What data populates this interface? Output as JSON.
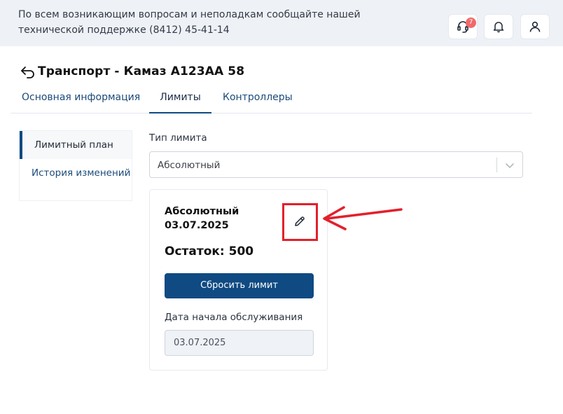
{
  "topbar": {
    "support_message": "По всем возникающим вопросам и неполадкам сообщайте нашей технической поддержке (8412) 45-41-14",
    "support_badge": "7"
  },
  "icons": {
    "support": "headset-icon",
    "notifications": "bell-icon",
    "user": "user-icon",
    "back": "back-arrow-icon",
    "edit": "pencil-icon",
    "dropdown": "chevron-down-icon"
  },
  "page": {
    "title": "Транспорт - Камаз А123АА 58"
  },
  "tabs": [
    {
      "label": "Основная информация",
      "active": false
    },
    {
      "label": "Лимиты",
      "active": true
    },
    {
      "label": "Контроллеры",
      "active": false
    }
  ],
  "side_nav": [
    {
      "label": "Лимитный план",
      "active": true
    },
    {
      "label": "История изменений",
      "active": false
    }
  ],
  "limit_type": {
    "label": "Тип лимита",
    "value": "Абсолютный"
  },
  "limit_card": {
    "type": "Абсолютный",
    "date": "03.07.2025",
    "remainder": "Остаток: 500",
    "reset_button": "Сбросить лимит",
    "service_start_label": "Дата начала обслуживания",
    "service_start_value": "03.07.2025"
  },
  "colors": {
    "primary": "#0f4a82",
    "topbar_bg": "#eef1f6",
    "badge": "#f06a6a",
    "annotation": "#e3202b"
  }
}
